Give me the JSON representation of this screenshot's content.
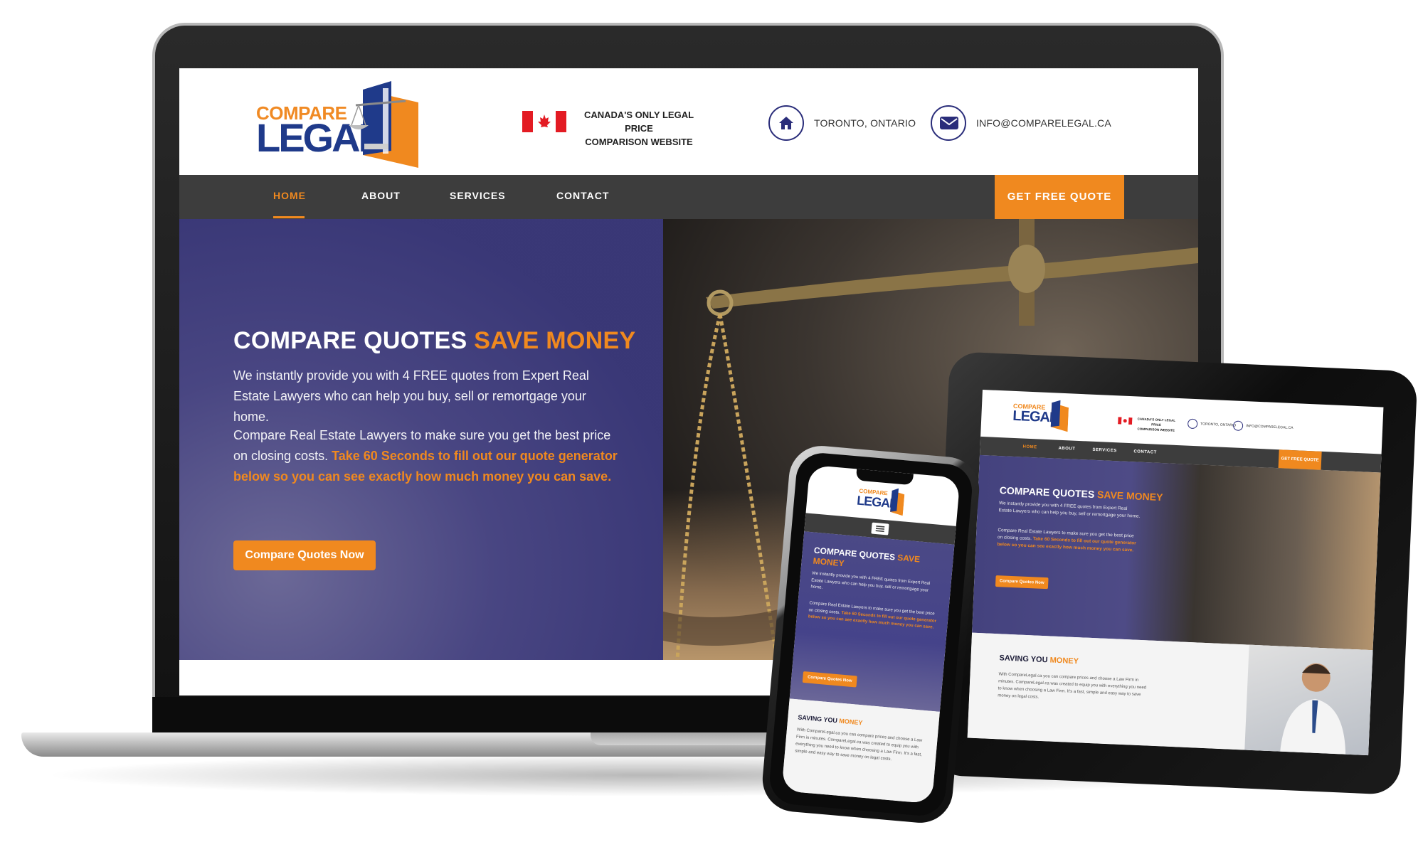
{
  "brand": {
    "logo_line1": "COMPARE",
    "logo_line2": "LEGAL",
    "tagline_line1": "CANADA'S ONLY LEGAL PRICE",
    "tagline_line2": "COMPARISON WEBSITE",
    "location": "TORONTO, ONTARIO",
    "email": "INFO@COMPARELEGAL.CA",
    "colors": {
      "accent": "#f0891f",
      "navy": "#1f3a8a",
      "nav_bg": "#3d3d3d",
      "hero_purple": "#4a4784"
    }
  },
  "icons": {
    "location": "home-icon",
    "email": "envelope-icon",
    "flag": "canada-flag-icon",
    "menu": "hamburger-menu-icon"
  },
  "nav": {
    "home": "HOME",
    "about": "ABOUT",
    "services": "SERVICES",
    "contact": "CONTACT",
    "cta": "GET FREE QUOTE"
  },
  "hero": {
    "title_main": "COMPARE QUOTES",
    "title_accent": "SAVE MONEY",
    "para1": "We instantly provide you with 4 FREE quotes from Expert Real Estate Lawyers who can help you buy, sell or remortgage your home.",
    "para2_plain": "Compare Real Estate Lawyers to make sure you get the best price on closing costs.",
    "para2_highlight": "Take 60 Seconds to fill out our quote generator below so you can see exactly how much money you can save.",
    "button": "Compare Quotes Now"
  },
  "tablet": {
    "saving_title": "SAVING YOU",
    "saving_accent": "MONEY",
    "saving_text": "With CompareLegal.ca you can compare prices and choose a Law Firm in minutes. CompareLegal.ca was created to equip you with everything you need to know when choosing a Law Firm. It's a fast, simple and easy way to save money on legal costs."
  },
  "phone": {
    "title_main": "COMPARE QUOTES",
    "title_accent": "SAVE MONEY",
    "saving_title": "SAVING YOU",
    "saving_accent": "MONEY",
    "saving_text": "With CompareLegal.ca you can compare prices and choose a Law Firm in minutes. CompareLegal.ca was created to equip you with everything you need to know when choosing a Law Firm. It's a fast, simple and easy way to save money on legal costs."
  }
}
